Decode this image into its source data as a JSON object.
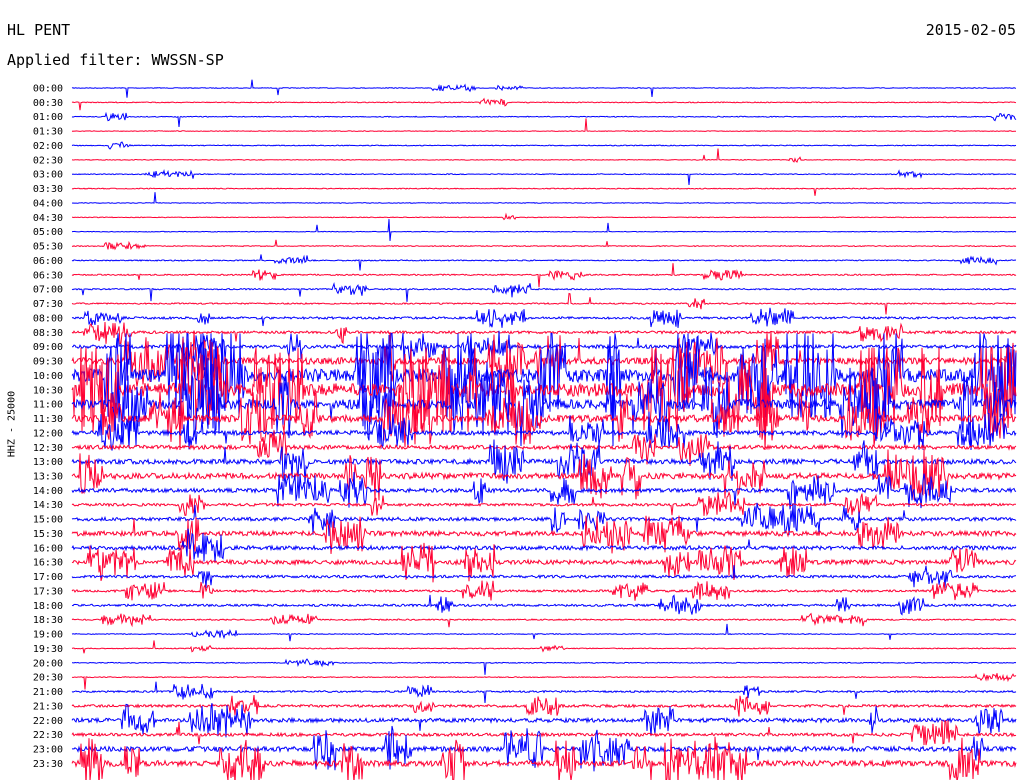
{
  "header": {
    "station": "HL PENT",
    "date": "2015-02-05",
    "filter": "Applied filter: WWSSN-SP"
  },
  "chart_data": {
    "type": "line",
    "ylabel": "HHZ - 25000",
    "colors": {
      "even": "#0000ff",
      "odd": "#ff0033"
    },
    "rows": [
      {
        "label": "00:00",
        "amp": 0.15
      },
      {
        "label": "00:30",
        "amp": 0.2
      },
      {
        "label": "01:00",
        "amp": 0.2
      },
      {
        "label": "01:30",
        "amp": 0.15
      },
      {
        "label": "02:00",
        "amp": 0.2
      },
      {
        "label": "02:30",
        "amp": 0.15
      },
      {
        "label": "03:00",
        "amp": 0.2
      },
      {
        "label": "03:30",
        "amp": 0.2
      },
      {
        "label": "04:00",
        "amp": 0.15
      },
      {
        "label": "04:30",
        "amp": 0.15
      },
      {
        "label": "05:00",
        "amp": 0.15
      },
      {
        "label": "05:30",
        "amp": 0.2
      },
      {
        "label": "06:00",
        "amp": 0.25
      },
      {
        "label": "06:30",
        "amp": 0.3
      },
      {
        "label": "07:00",
        "amp": 0.3
      },
      {
        "label": "07:30",
        "amp": 0.3
      },
      {
        "label": "08:00",
        "amp": 0.5
      },
      {
        "label": "08:30",
        "amp": 0.6
      },
      {
        "label": "09:00",
        "amp": 0.8
      },
      {
        "label": "09:30",
        "amp": 1.5
      },
      {
        "label": "10:00",
        "amp": 3.0
      },
      {
        "label": "10:30",
        "amp": 3.0
      },
      {
        "label": "11:00",
        "amp": 2.2
      },
      {
        "label": "11:30",
        "amp": 1.6
      },
      {
        "label": "12:00",
        "amp": 1.0
      },
      {
        "label": "12:30",
        "amp": 0.9
      },
      {
        "label": "13:00",
        "amp": 1.1
      },
      {
        "label": "13:30",
        "amp": 1.3
      },
      {
        "label": "14:00",
        "amp": 0.9
      },
      {
        "label": "14:30",
        "amp": 0.6
      },
      {
        "label": "15:00",
        "amp": 0.8
      },
      {
        "label": "15:30",
        "amp": 1.1
      },
      {
        "label": "16:00",
        "amp": 0.9
      },
      {
        "label": "16:30",
        "amp": 1.0
      },
      {
        "label": "17:00",
        "amp": 0.6
      },
      {
        "label": "17:30",
        "amp": 0.5
      },
      {
        "label": "18:00",
        "amp": 0.5
      },
      {
        "label": "18:30",
        "amp": 0.3
      },
      {
        "label": "19:00",
        "amp": 0.2
      },
      {
        "label": "19:30",
        "amp": 0.2
      },
      {
        "label": "20:00",
        "amp": 0.2
      },
      {
        "label": "20:30",
        "amp": 0.2
      },
      {
        "label": "21:00",
        "amp": 0.4
      },
      {
        "label": "21:30",
        "amp": 0.6
      },
      {
        "label": "22:00",
        "amp": 0.9
      },
      {
        "label": "22:30",
        "amp": 0.7
      },
      {
        "label": "23:00",
        "amp": 1.1
      },
      {
        "label": "23:30",
        "amp": 1.3
      }
    ]
  }
}
